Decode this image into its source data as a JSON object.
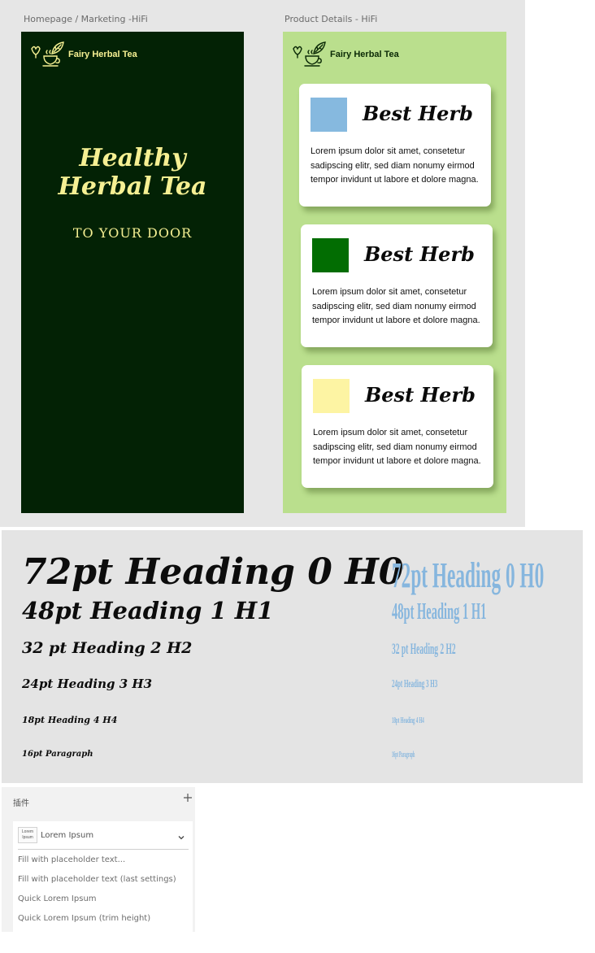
{
  "boards": {
    "home_label": "Homepage / Marketing -HiFi",
    "product_label": "Product Details - HiFi"
  },
  "brand": {
    "name": "Fairy Herbal Tea",
    "logo_icon": "herbal-tea-cup-icon"
  },
  "home": {
    "headline_line1": "Healthy",
    "headline_line2": "Herbal Tea",
    "tagline": "TO YOUR DOOR",
    "colors": {
      "background": "#032205",
      "accent": "#f6f093"
    }
  },
  "product": {
    "background": "#badf8d",
    "cards": [
      {
        "title": "Best Herb",
        "swatch": "#86b9df",
        "text": "Lorem ipsum dolor sit amet, consetetur sadipscing elitr, sed diam nonumy eirmod tempor invidunt ut labore et dolore magna."
      },
      {
        "title": "Best Herb",
        "swatch": "#026d02",
        "text": "Lorem ipsum dolor sit amet, consetetur sadipscing elitr, sed diam nonumy eirmod tempor invidunt ut labore et dolore magna."
      },
      {
        "title": "Best Herb",
        "swatch": "#fdf4a3",
        "text": "Lorem ipsum dolor sit amet, consetetur sadipscing elitr, sed diam nonumy eirmod tempor invidunt ut labore et dolore magna."
      }
    ]
  },
  "typography": {
    "styles": [
      "72pt Heading 0 H0",
      "48pt Heading 1 H1",
      "32 pt Heading 2 H2",
      "24pt Heading 3 H3",
      "18pt Heading 4 H4",
      "16pt Paragraph"
    ],
    "colors": {
      "primary": "#0c0c0c",
      "secondary": "#86b6de"
    }
  },
  "plugins": {
    "header": "插件",
    "add_icon": "plus-icon",
    "selected_plugin": "Lorem Ipsum",
    "thumb_line1": "Lorem",
    "thumb_line2": "Ipsum",
    "commands": [
      "Fill with placeholder text...",
      "Fill with placeholder text (last settings)",
      "Quick Lorem Ipsum",
      "Quick Lorem Ipsum (trim height)"
    ]
  }
}
